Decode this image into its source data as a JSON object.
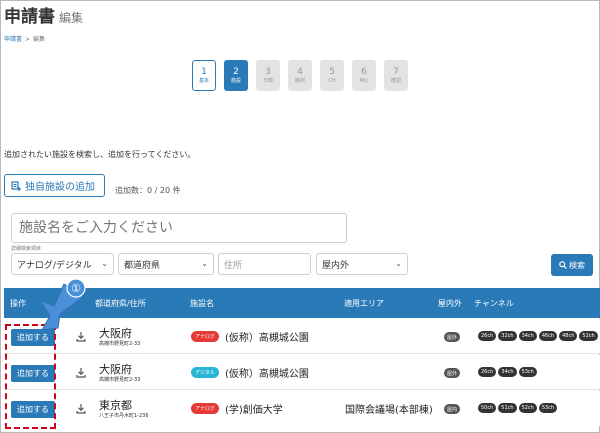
{
  "page": {
    "title": "申請書",
    "subtitle": "編集"
  },
  "breadcrumb": {
    "home": "申請書",
    "sep": ">",
    "current": "編集"
  },
  "steps": [
    {
      "num": "1",
      "label": "基本",
      "state": "done"
    },
    {
      "num": "2",
      "label": "施設",
      "state": "active"
    },
    {
      "num": "3",
      "label": "日時",
      "state": "todo"
    },
    {
      "num": "4",
      "label": "機材",
      "state": "todo"
    },
    {
      "num": "5",
      "label": "CH",
      "state": "todo"
    },
    {
      "num": "6",
      "label": "Mic",
      "state": "todo"
    },
    {
      "num": "7",
      "label": "確認",
      "state": "todo"
    }
  ],
  "instruction": "追加されたい施設を検索し、追加を行ってください。",
  "add_own_label": "独自施設の追加",
  "added_count": "追加数：0 / 20 件",
  "search": {
    "placeholder": "施設名をご入力ください",
    "filter_label": "詳細検索項目",
    "type_select": "アナログ/デジタル",
    "pref_select": "都道府県",
    "address_placeholder": "住所",
    "io_select": "屋内外",
    "search_button": "検索"
  },
  "table": {
    "headers": {
      "action": "操作",
      "pref": "都道府県/住所",
      "facility": "施設名",
      "area": "適用エリア",
      "io": "屋内外",
      "channel": "チャンネル"
    },
    "rows": [
      {
        "add": "追加する",
        "pref": "大阪府",
        "addr": "高槻市野見町2-33",
        "badge": "アナログ",
        "badge_color": "#e53935",
        "facility": "(仮称）高槻城公園",
        "area": "",
        "io": "屋外",
        "channels": [
          "26ch",
          "32ch",
          "34ch",
          "46ch",
          "48ch",
          "52ch"
        ]
      },
      {
        "add": "追加する",
        "pref": "大阪府",
        "addr": "高槻市野見町2-33",
        "badge": "デジタル",
        "badge_color": "#29b6d6",
        "facility": "(仮称）高槻城公園",
        "area": "",
        "io": "屋外",
        "channels": [
          "26ch",
          "34ch",
          "53ch"
        ]
      },
      {
        "add": "追加する",
        "pref": "東京都",
        "addr": "八王子市丹木町1-236",
        "badge": "アナログ",
        "badge_color": "#e53935",
        "facility": "(学)創価大学",
        "area": "国際会議場(本部棟)",
        "io": "屋内",
        "channels": [
          "50ch",
          "51ch",
          "52ch",
          "53ch"
        ]
      }
    ]
  },
  "annotation": {
    "marker": "①",
    "color": "#d0021b",
    "arrow_color": "#4a90d9"
  },
  "colors": {
    "primary": "#2a7ab7"
  }
}
